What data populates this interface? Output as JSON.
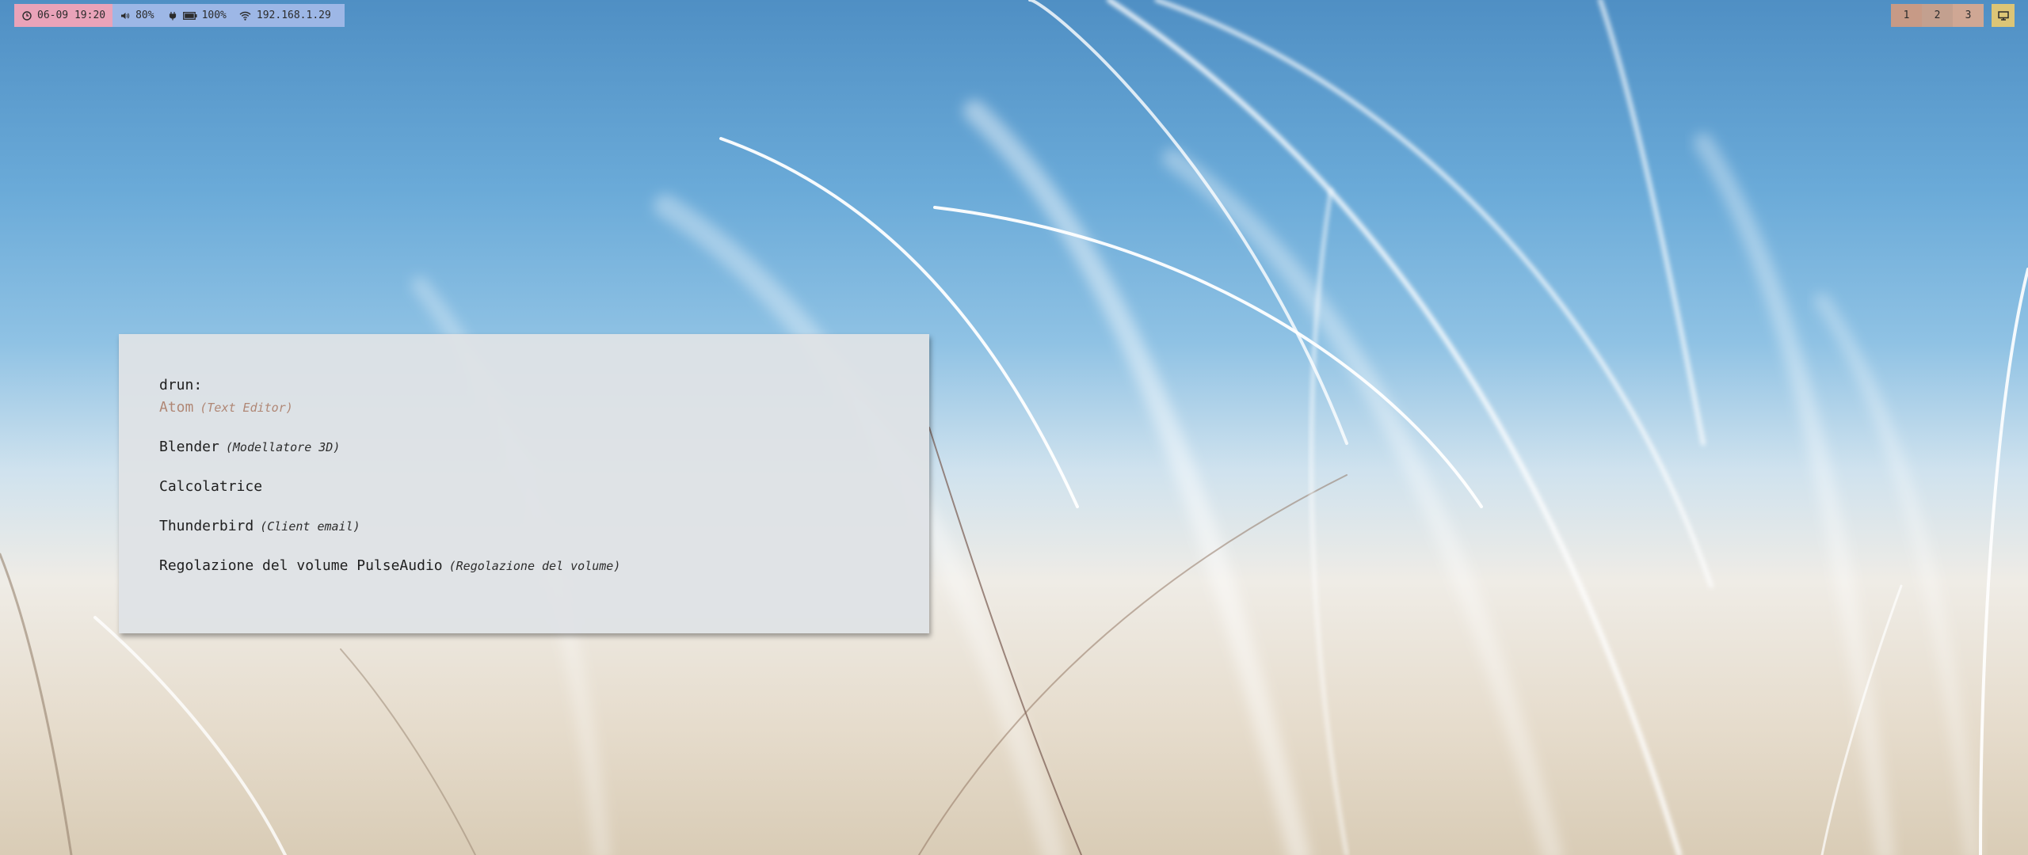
{
  "topbar": {
    "clock": {
      "icon": "clock-icon",
      "text": "06-09 19:20"
    },
    "volume": {
      "icon": "speaker-icon",
      "text": "80%"
    },
    "battery": {
      "plug_icon": "plug-icon",
      "icon": "battery-icon",
      "text": "100%"
    },
    "network": {
      "icon": "wifi-icon",
      "text": "192.168.1.29"
    },
    "workspaces": [
      {
        "label": "1"
      },
      {
        "label": "2"
      },
      {
        "label": "3"
      }
    ],
    "monitor": {
      "icon": "monitor-icon"
    }
  },
  "launcher": {
    "prompt": "drun:",
    "entries": [
      {
        "name": "Atom",
        "description": "(Text Editor)",
        "selected": true
      },
      {
        "name": "Blender",
        "description": "(Modellatore 3D)",
        "selected": false
      },
      {
        "name": "Calcolatrice",
        "description": "",
        "selected": false
      },
      {
        "name": "Thunderbird",
        "description": "(Client email)",
        "selected": false
      },
      {
        "name": "Regolazione del volume PulseAudio",
        "description": "(Regolazione del volume)",
        "selected": false
      }
    ]
  },
  "colors": {
    "clock_block": "#e9a3b9",
    "status_block": "#9db7e6",
    "workspace_1": "#c79a86",
    "workspace_2": "#c3a08f",
    "workspace_3": "#cfa794",
    "monitor_block": "#dcc576",
    "selected_entry": "#b08775"
  }
}
